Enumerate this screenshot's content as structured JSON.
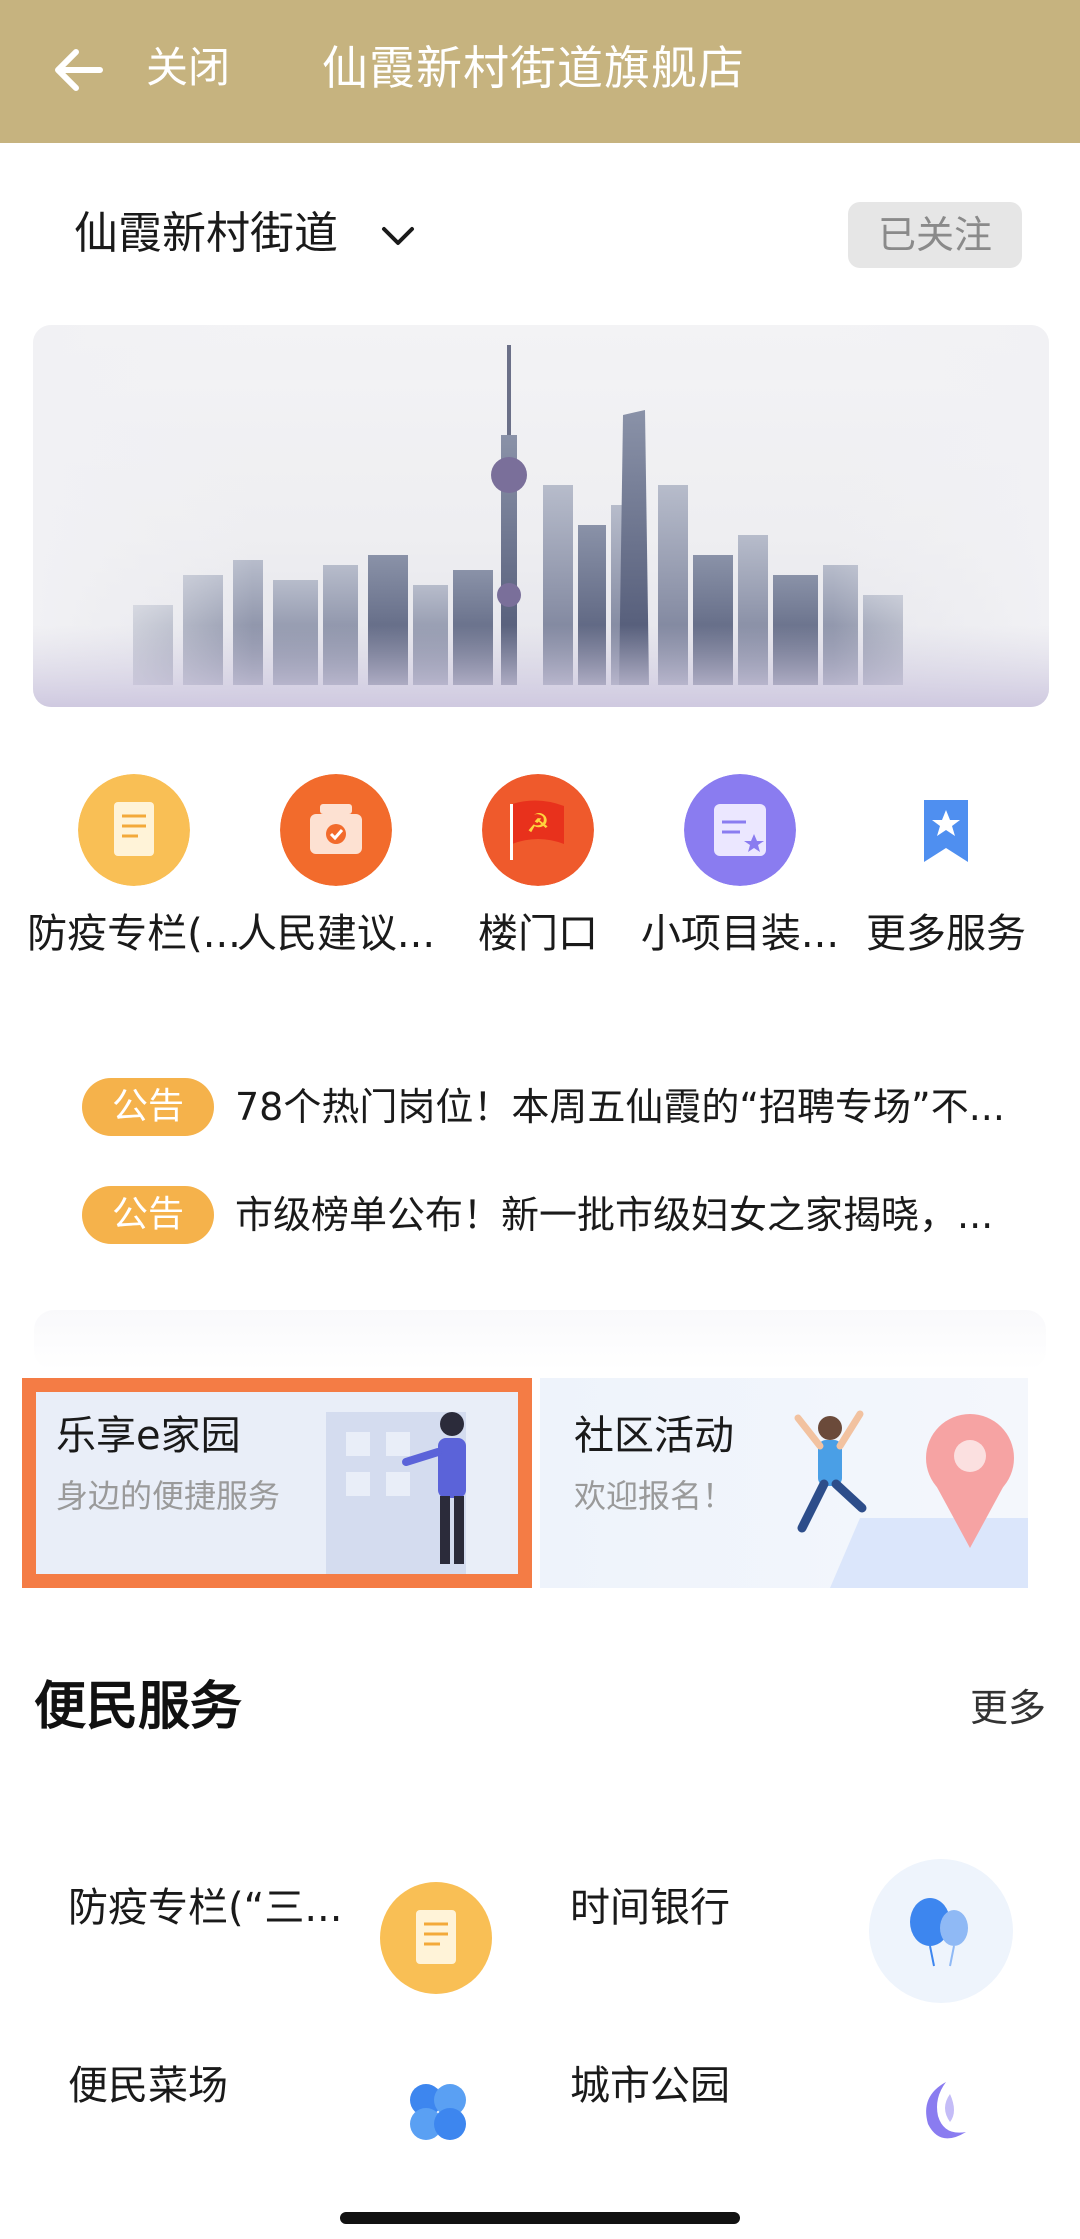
{
  "header": {
    "back_icon": "arrow-left-icon",
    "close_label": "关闭",
    "title": "仙霞新村街道旗舰店",
    "background_color": "#c6b37f"
  },
  "store": {
    "name": "仙霞新村街道",
    "dropdown_icon": "chevron-down-icon",
    "follow_label": "已关注"
  },
  "banner": {
    "description_icon": "city-skyline-image"
  },
  "quick_services": [
    {
      "label": "防疫专栏(...",
      "icon": "document-icon",
      "color": "#f7b340"
    },
    {
      "label": "人民建议...",
      "icon": "suggestion-box-icon",
      "color": "#f26b2c"
    },
    {
      "label": "楼门口",
      "icon": "party-flag-icon",
      "color": "#ef5a2c"
    },
    {
      "label": "小项目装...",
      "icon": "enterprise-certificate-icon",
      "color": "#8a7cf0"
    },
    {
      "label": "更多服务",
      "icon": "bookmark-star-icon",
      "color": "#4f8ff0"
    }
  ],
  "notices": [
    {
      "badge": "公告",
      "text": "78个热门岗位！本周五仙霞的“招聘专场”不..."
    },
    {
      "badge": "公告",
      "text": "市级榜单公布！新一批市级妇女之家揭晓，..."
    }
  ],
  "feature_cards": {
    "home": {
      "title": "乐享e家园",
      "subtitle": "身边的便捷服务",
      "highlight_color": "#f47c45"
    },
    "activity": {
      "title": "社区活动",
      "subtitle": "欢迎报名！"
    }
  },
  "convenience": {
    "title": "便民服务",
    "more_label": "更多",
    "items": [
      {
        "label": "防疫专栏(“三...",
        "icon": "document-icon"
      },
      {
        "label": "时间银行",
        "icon": "balloon-icon"
      },
      {
        "label": "便民菜场",
        "icon": "clover-icon"
      },
      {
        "label": "城市公园",
        "icon": "moon-swirl-icon"
      }
    ]
  }
}
